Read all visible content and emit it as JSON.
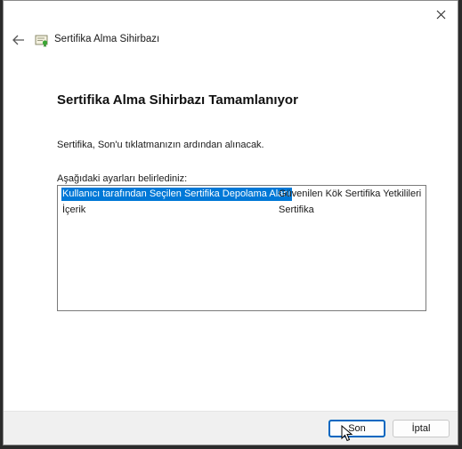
{
  "window": {
    "title": "Sertifika Alma Sihirbazı"
  },
  "page": {
    "heading": "Sertifika Alma Sihirbazı Tamamlanıyor",
    "description": "Sertifika, Son'u tıklatmanızın ardından alınacak.",
    "settings_label": "Aşağıdaki ayarları belirlediniz:"
  },
  "settings": [
    {
      "name": "Kullanıcı tarafından Seçilen Sertifika Depolama Alanı",
      "value": "Güvenilen Kök Sertifika Yetkilileri",
      "selected": true
    },
    {
      "name": "İçerik",
      "value": "Sertifika",
      "selected": false
    }
  ],
  "buttons": {
    "finish": "Son",
    "cancel": "İptal"
  },
  "icons": {
    "close": "close-icon",
    "back": "back-arrow-icon",
    "wizard": "certificate-icon",
    "cursor": "mouse-pointer-icon"
  },
  "colors": {
    "selection": "#0078d7",
    "accent": "#0067c0"
  }
}
